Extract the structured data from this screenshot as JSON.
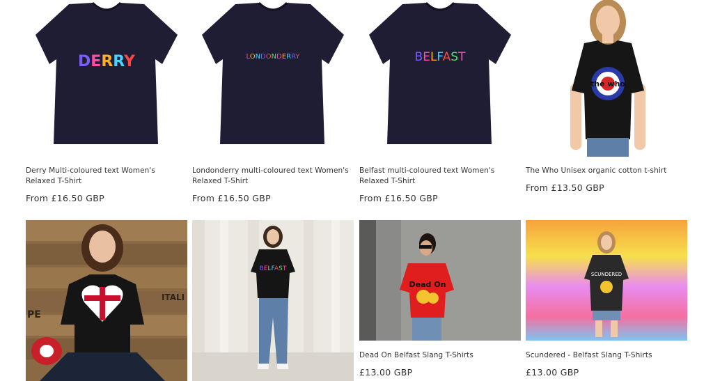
{
  "products": [
    {
      "title": "Derry Multi-coloured text Women's Relaxed T-Shirt",
      "price": "From £16.50 GBP",
      "print": "DERRY"
    },
    {
      "title": "Londonderry multi-coloured text Women's Relaxed T-Shirt",
      "price": "From £16.50 GBP",
      "print": "LONDONDERRY"
    },
    {
      "title": "Belfast multi-coloured text Women's Relaxed T-Shirt",
      "price": "From £16.50 GBP",
      "print": "BELFAST"
    },
    {
      "title": "The Who Unisex organic cotton t-shirt",
      "price": "From £13.50 GBP",
      "print": "the who"
    },
    {
      "title": "",
      "price": "",
      "print": ""
    },
    {
      "title": "",
      "price": "",
      "print": "BELFAST"
    },
    {
      "title": "Dead On Belfast Slang T-Shirts",
      "price": "£13.00 GBP",
      "print": "Dead On"
    },
    {
      "title": "Scundered - Belfast Slang T-Shirts",
      "price": "£13.00 GBP",
      "print": "SCUNDERED"
    }
  ],
  "colors": {
    "navy_shirt": "#1e1d33",
    "black_shirt": "#161616",
    "text": "#333333"
  }
}
